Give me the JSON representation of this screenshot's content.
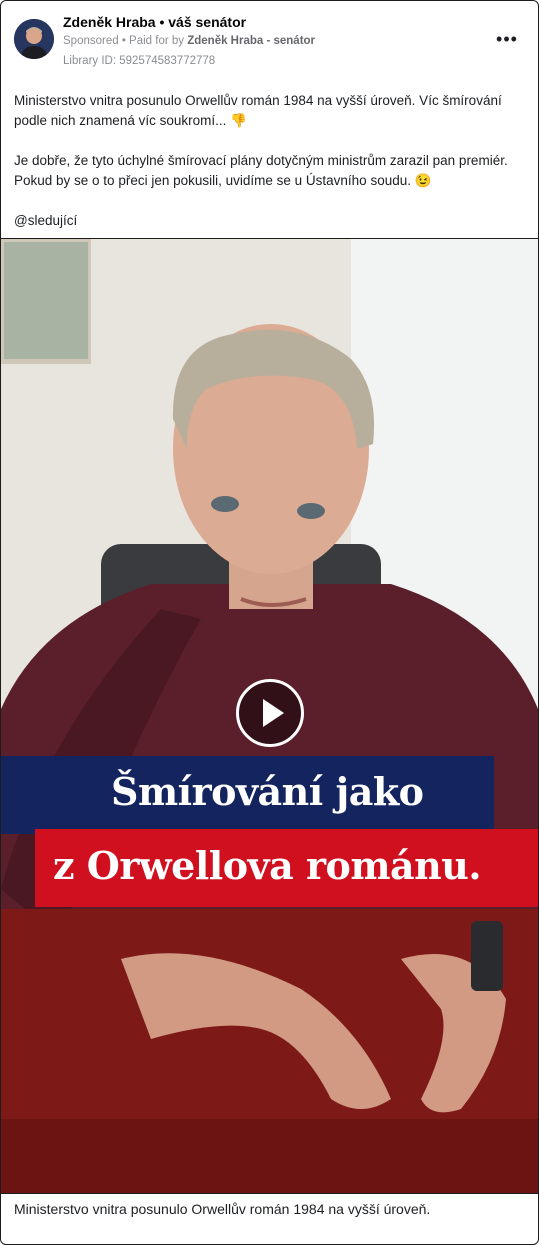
{
  "post": {
    "page_name": "Zdeněk Hraba • váš senátor",
    "sponsored": "Sponsored",
    "paid_for_prefix": " • Paid for by ",
    "paid_for_by": "Zdeněk Hraba - senátor",
    "library_id": "Library ID: 592574583772778",
    "more_glyph": "•••",
    "paragraphs": [
      "Ministerstvo vnitra posunulo Orwellův román 1984 na vyšší úroveň. Víc šmírování podle nich znamená víc soukromí... 👎",
      "Je dobře, že tyto úchylné šmírovací plány dotyčným ministrům zarazil pan premiér. Pokud by se o to přeci jen pokusili, uvidíme se u Ústavního soudu. 😉",
      "@sledující"
    ],
    "video_overlay": {
      "line1": "Šmírování jako",
      "line2": "z Orwellova románu."
    },
    "caption": "Ministerstvo vnitra posunulo Orwellův román 1984 na vyšší úroveň."
  },
  "colors": {
    "banner_blue": "#13245e",
    "banner_red": "#d0101f",
    "sweater": "#5a1f2a",
    "desk": "#6b1412"
  }
}
